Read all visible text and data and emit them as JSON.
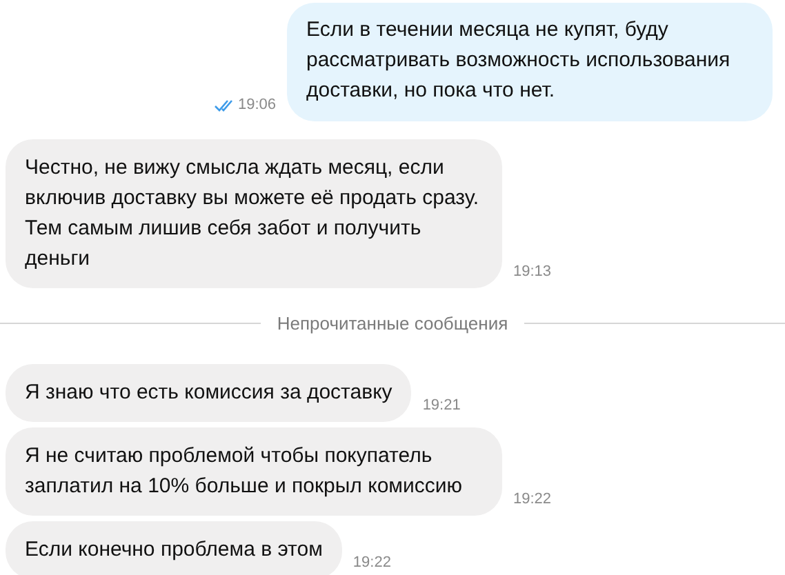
{
  "messages": [
    {
      "kind": "outgoing",
      "text": "Если в течении месяца не купят, буду рассматривать возможность использования доставки, но пока что нет.",
      "time": "19:06",
      "read": true
    },
    {
      "kind": "incoming",
      "text": "Честно, не вижу смысла ждать месяц, если включив доставку вы можете её продать сразу. Тем самым лишив себя забот и получить деньги",
      "time": "19:13"
    },
    {
      "kind": "divider",
      "text": "Непрочитанные сообщения"
    },
    {
      "kind": "incoming",
      "text": "Я знаю что есть комиссия за доставку",
      "time": "19:21"
    },
    {
      "kind": "incoming",
      "text": "Я не считаю проблемой чтобы покупатель заплатил на 10% больше и покрыл комиссию",
      "time": "19:22"
    },
    {
      "kind": "incoming",
      "text": "Если конечно проблема в этом",
      "time": "19:22"
    }
  ]
}
